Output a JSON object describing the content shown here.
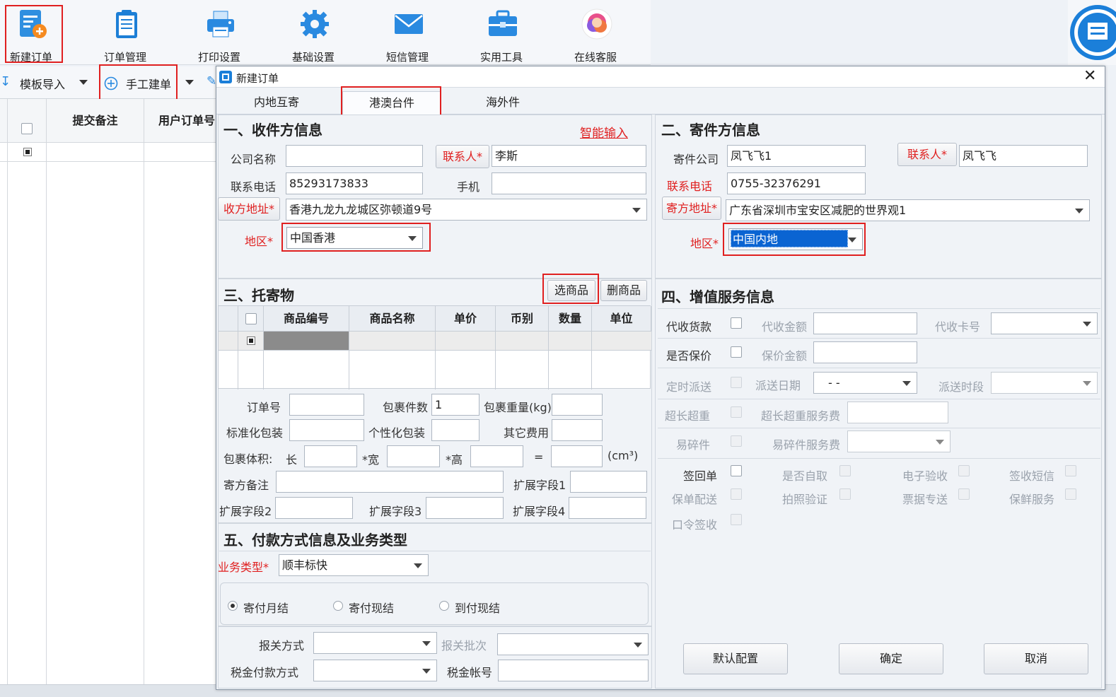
{
  "toolbar": {
    "items": [
      {
        "label": "新建订单",
        "icon": "new-order-icon"
      },
      {
        "label": "订单管理",
        "icon": "clipboard-icon"
      },
      {
        "label": "打印设置",
        "icon": "printer-icon"
      },
      {
        "label": "基础设置",
        "icon": "gear-icon"
      },
      {
        "label": "短信管理",
        "icon": "envelope-icon"
      },
      {
        "label": "实用工具",
        "icon": "toolbox-icon"
      },
      {
        "label": "在线客服",
        "icon": "support-avatar-icon"
      }
    ]
  },
  "subbar": {
    "template_import": "模板导入",
    "manual_order": "手工建单"
  },
  "order_grid": {
    "columns": [
      "提交备注",
      "用户订单号"
    ]
  },
  "dialog": {
    "title": "新建订单",
    "tabs": [
      "内地互寄",
      "港澳台件",
      "海外件"
    ],
    "active_tab": "港澳台件"
  },
  "recipient": {
    "section_title": "一、收件方信息",
    "smart_input": "智能输入",
    "company_label": "公司名称",
    "company_value": "",
    "contact_label": "联系人*",
    "contact_value": "李斯",
    "phone_label": "联系电话",
    "phone_value": "85293173833",
    "mobile_label": "手机",
    "mobile_value": "",
    "address_label": "收方地址*",
    "address_value": "香港九龙九龙城区弥顿道9号",
    "region_label": "地区*",
    "region_value": "中国香港"
  },
  "sender": {
    "section_title": "二、寄件方信息",
    "company_label": "寄件公司",
    "company_value": "凤飞飞1",
    "contact_label": "联系人*",
    "contact_value": "凤飞飞",
    "phone_label": "联系电话",
    "phone_value": "0755-32376291",
    "address_label": "寄方地址*",
    "address_value": "广东省深圳市宝安区减肥的世界观1",
    "region_label": "地区*",
    "region_value": "中国内地"
  },
  "goods": {
    "section_title": "三、托寄物",
    "select_button": "选商品",
    "delete_button": "删商品",
    "columns": [
      "商品编号",
      "商品名称",
      "单价",
      "币别",
      "数量",
      "单位"
    ]
  },
  "parcel": {
    "order_no_label": "订单号",
    "order_no_value": "",
    "pieces_label": "包裹件数",
    "pieces_value": "1",
    "weight_label": "包裹重量(kg)",
    "weight_value": "",
    "std_pack_label": "标准化包装",
    "custom_pack_label": "个性化包装",
    "other_fee_label": "其它费用",
    "volume_label": "包裹体积:",
    "length_label": "长",
    "width_label": "*宽",
    "height_label": "*高",
    "equals_label": "=",
    "unit_label": "(cm³)",
    "remark_label": "寄方备注",
    "ext1_label": "扩展字段1",
    "ext2_label": "扩展字段2",
    "ext3_label": "扩展字段3",
    "ext4_label": "扩展字段4"
  },
  "value_added": {
    "section_title": "四、增值服务信息",
    "cod_label": "代收货款",
    "cod_amount_label": "代收金额",
    "cod_card_label": "代收卡号",
    "insure_label": "是否保价",
    "insure_amount_label": "保价金额",
    "timed_label": "定时派送",
    "delivery_date_label": "派送日期",
    "delivery_date_value": "-  -",
    "delivery_period_label": "派送时段",
    "oversize_label": "超长超重",
    "oversize_fee_label": "超长超重服务费",
    "fragile_label": "易碎件",
    "fragile_fee_label": "易碎件服务费",
    "options": [
      "签回单",
      "是否自取",
      "电子验收",
      "签收短信",
      "保单配送",
      "拍照验证",
      "票据专送",
      "保鲜服务",
      "口令签收"
    ]
  },
  "payment": {
    "section_title": "五、付款方式信息及业务类型",
    "biz_type_label": "业务类型*",
    "biz_type_value": "顺丰标快",
    "pay_options": [
      "寄付月结",
      "寄付现结",
      "到付现结"
    ],
    "selected_pay": "寄付月结",
    "customs_label": "报关方式",
    "customs_batch_label": "报关批次",
    "tax_pay_label": "税金付款方式",
    "tax_account_label": "税金帐号"
  },
  "footer_buttons": {
    "default": "默认配置",
    "ok": "确定",
    "cancel": "取消"
  }
}
